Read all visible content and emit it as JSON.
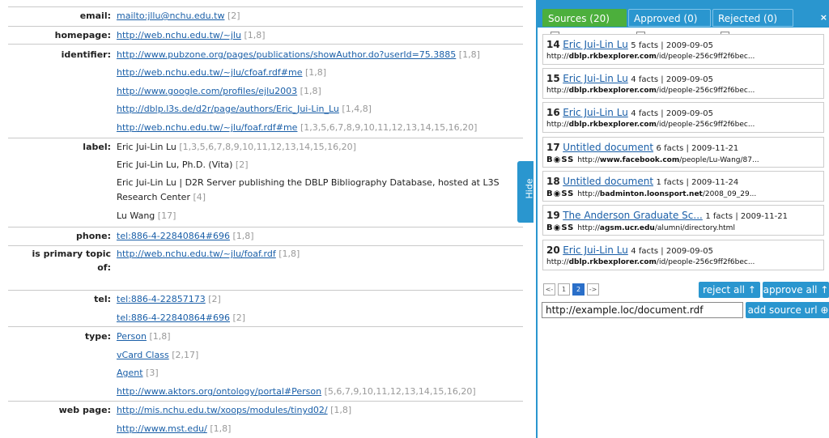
{
  "properties": {
    "email": {
      "label": "email:",
      "values": [
        {
          "link": "mailto:jllu@nchu.edu.tw",
          "ref": "[2]"
        }
      ]
    },
    "homepage": {
      "label": "homepage:",
      "values": [
        {
          "link": "http://web.nchu.edu.tw/~jlu",
          "ref": "[1,8]"
        }
      ]
    },
    "identifier": {
      "label": "identifier:",
      "values": [
        {
          "link": "http://www.pubzone.org/pages/publications/showAuthor.do?userId=75.3885",
          "ref": "[1,8]"
        },
        {
          "link": "http://web.nchu.edu.tw/~jlu/cfoaf.rdf#me",
          "ref": "[1,8]"
        },
        {
          "link": "http://www.google.com/profiles/ejlu2003",
          "ref": "[1,8]"
        },
        {
          "link": "http://dblp.l3s.de/d2r/page/authors/Eric_Jui-Lin_Lu",
          "ref": "[1,4,8]"
        },
        {
          "link": "http://web.nchu.edu.tw/~jlu/foaf.rdf#me",
          "ref": "[1,3,5,6,7,8,9,10,11,12,13,14,15,16,20]"
        }
      ]
    },
    "label": {
      "label": "label:",
      "values": [
        {
          "text": "Eric Jui-Lin Lu",
          "ref": "[1,3,5,6,7,8,9,10,11,12,13,14,15,16,20]"
        },
        {
          "text": "Eric Jui-Lin Lu, Ph.D. (Vita)",
          "ref": "[2]"
        },
        {
          "text": "Eric Jui-Lin Lu | D2R Server publishing the DBLP Bibliography Database, hosted at L3S",
          "ref": ""
        },
        {
          "text": "Research Center",
          "ref": "[4]"
        },
        {
          "text": "Lu Wang",
          "ref": "[17]"
        }
      ]
    },
    "phone": {
      "label": "phone:",
      "values": [
        {
          "link": "tel:886-4-22840864#696",
          "ref": "[1,8]"
        }
      ]
    },
    "primary_topic": {
      "label1": "is primary topic",
      "label2": "of:",
      "values": [
        {
          "link": "http://web.nchu.edu.tw/~jlu/foaf.rdf",
          "ref": "[1,8]"
        }
      ]
    },
    "tel": {
      "label": "tel:",
      "values": [
        {
          "link": "tel:886-4-22857173",
          "ref": "[2]"
        },
        {
          "link": "tel:886-4-22840864#696",
          "ref": "[2]"
        }
      ]
    },
    "type": {
      "label": "type:",
      "values": [
        {
          "link": "Person",
          "ref": "[1,8]"
        },
        {
          "link": "vCard Class",
          "ref": "[2,17]"
        },
        {
          "link": "Agent",
          "ref": "[3]"
        },
        {
          "link": "http://www.aktors.org/ontology/portal#Person",
          "ref": "[5,6,7,9,10,11,12,13,14,15,16,20]"
        }
      ]
    },
    "web_page": {
      "label": "web page:",
      "values": [
        {
          "link": "http://mis.nchu.edu.tw/xoops/modules/tinyd02/",
          "ref": "[1,8]"
        },
        {
          "link": "http://www.mst.edu/",
          "ref": "[1,8]"
        }
      ]
    }
  },
  "hide_tab": "Hide",
  "tabs": {
    "sources": {
      "label": "Sources",
      "count": "(20)"
    },
    "approved": {
      "label": "Approved",
      "count": "(0)"
    },
    "rejected": {
      "label": "Rejected",
      "count": "(0)"
    },
    "close": "×"
  },
  "sources": [
    {
      "num": "14",
      "title": "Eric Jui-Lin Lu",
      "facts": "5 facts | 2009-09-05",
      "prefix": "http://",
      "domain": "dblp.rkbexplorer.com",
      "path": "/id/people-256c9ff2f6bec...",
      "boss": false
    },
    {
      "num": "15",
      "title": "Eric Jui-Lin Lu",
      "facts": "4 facts | 2009-09-05",
      "prefix": "http://",
      "domain": "dblp.rkbexplorer.com",
      "path": "/id/people-256c9ff2f6bec...",
      "boss": false
    },
    {
      "num": "16",
      "title": "Eric Jui-Lin Lu",
      "facts": "4 facts | 2009-09-05",
      "prefix": "http://",
      "domain": "dblp.rkbexplorer.com",
      "path": "/id/people-256c9ff2f6bec...",
      "boss": false
    },
    {
      "num": "17",
      "title": "Untitled document",
      "facts": "6 facts | 2009-11-21",
      "prefix": "http://",
      "domain": "www.facebook.com",
      "path": "/people/Lu-Wang/87...",
      "boss": true
    },
    {
      "num": "18",
      "title": "Untitled document",
      "facts": "1 facts | 2009-11-24",
      "prefix": "http://",
      "domain": "badminton.loonsport.net",
      "path": "/2008_09_29...",
      "boss": true
    },
    {
      "num": "19",
      "title": "The Anderson Graduate Sc...",
      "facts": "1 facts | 2009-11-21",
      "prefix": "http://",
      "domain": "agsm.ucr.edu",
      "path": "/alumni/directory.html",
      "boss": true
    },
    {
      "num": "20",
      "title": "Eric Jui-Lin Lu",
      "facts": "4 facts | 2009-09-05",
      "prefix": "http://",
      "domain": "dblp.rkbexplorer.com",
      "path": "/id/people-256c9ff2f6bec...",
      "boss": false
    }
  ],
  "boss_label": "B◉SS",
  "pagination": {
    "prev": "<-",
    "p1": "1",
    "p2": "2",
    "next": "->"
  },
  "buttons": {
    "reject_all": "reject all ↑",
    "approve_all": "approve all ↑",
    "add_source": "add source url ⊕"
  },
  "url_input": {
    "value": "http://example.loc/document.rdf"
  },
  "colors": {
    "accent": "#2a96cf",
    "selected_tab": "#4caf3c",
    "link": "#1a5fa8"
  }
}
